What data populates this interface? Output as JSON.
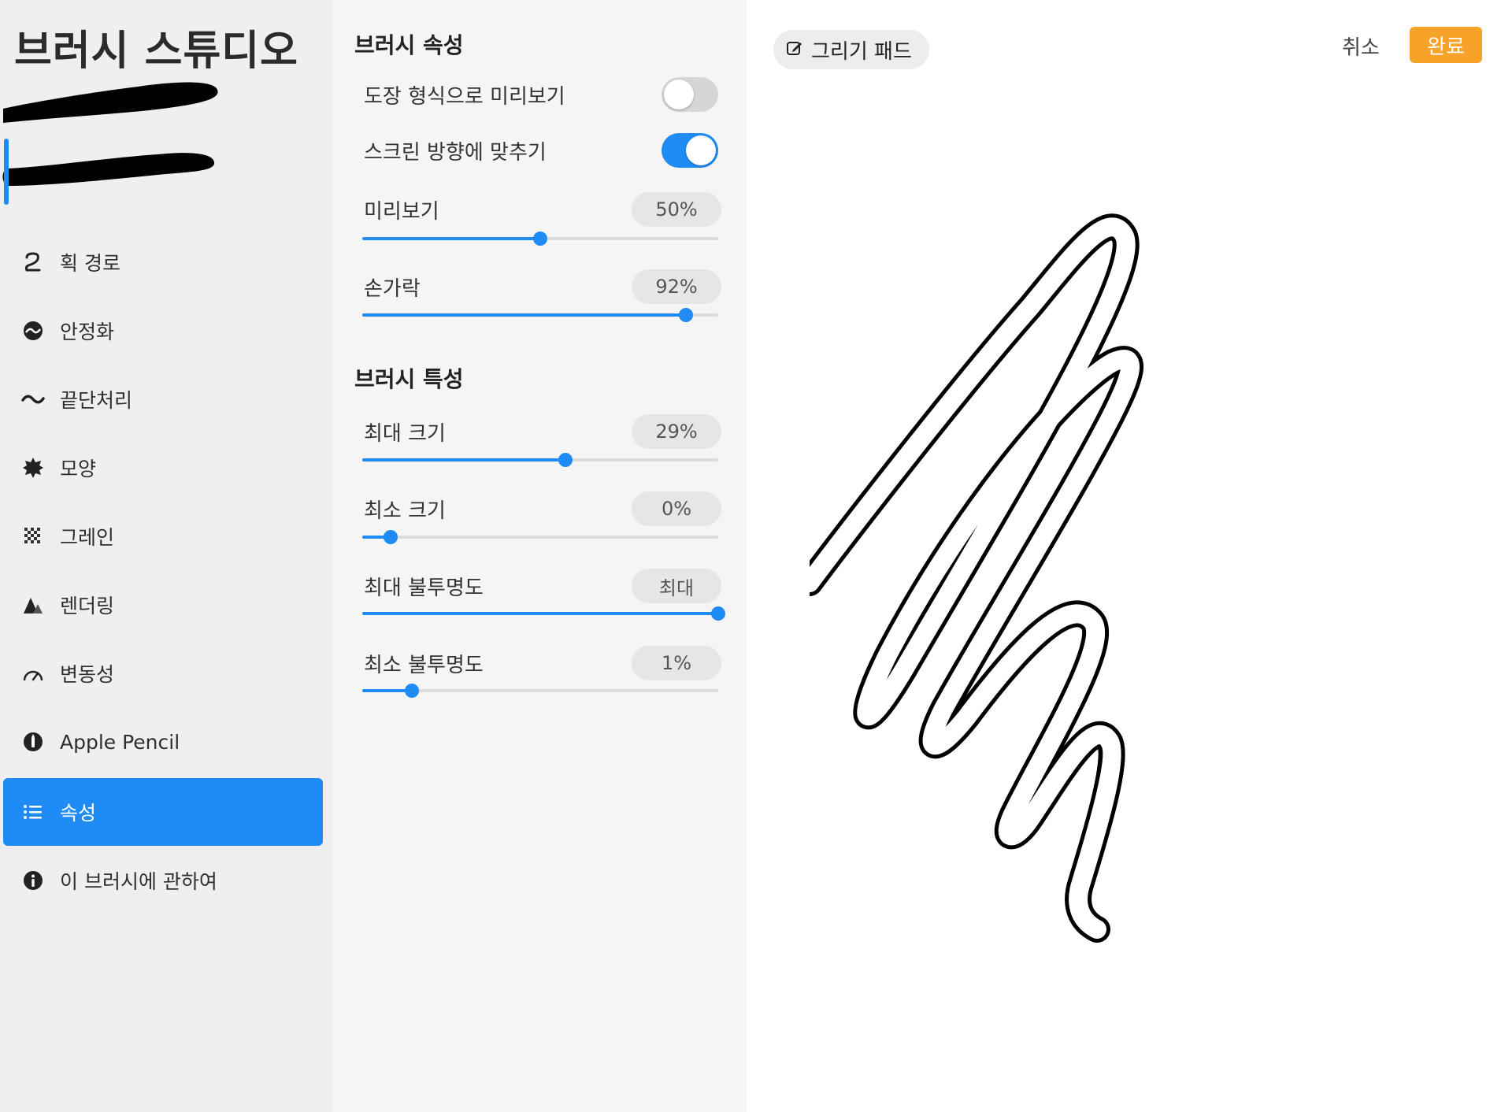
{
  "sidebar": {
    "title": "브러시 스튜디오",
    "items": [
      {
        "label": "획 경로",
        "icon": "stroke-path-icon"
      },
      {
        "label": "안정화",
        "icon": "stabilization-icon"
      },
      {
        "label": "끝단처리",
        "icon": "taper-icon"
      },
      {
        "label": "모양",
        "icon": "shape-icon"
      },
      {
        "label": "그레인",
        "icon": "grain-icon"
      },
      {
        "label": "렌더링",
        "icon": "rendering-icon"
      },
      {
        "label": "변동성",
        "icon": "dynamics-icon"
      },
      {
        "label": "Apple Pencil",
        "icon": "apple-pencil-icon"
      },
      {
        "label": "속성",
        "icon": "properties-icon",
        "active": true
      },
      {
        "label": "이 브러시에 관하여",
        "icon": "info-icon"
      }
    ]
  },
  "settings": {
    "properties_title": "브러시 속성",
    "preview_stamp": {
      "label": "도장 형식으로 미리보기",
      "on": false
    },
    "orient_screen": {
      "label": "스크린 방향에 맞추기",
      "on": true
    },
    "preview": {
      "label": "미리보기",
      "value": "50%",
      "fraction": 0.5
    },
    "finger": {
      "label": "손가락",
      "value": "92%",
      "fraction": 0.91
    },
    "behavior_title": "브러시 특성",
    "max_size": {
      "label": "최대 크기",
      "value": "29%",
      "fraction": 0.57
    },
    "min_size": {
      "label": "최소 크기",
      "value": "0%",
      "fraction": 0.08
    },
    "max_opacity": {
      "label": "최대 불투명도",
      "value": "최대",
      "fraction": 1.0
    },
    "min_opacity": {
      "label": "최소 불투명도",
      "value": "1%",
      "fraction": 0.14
    }
  },
  "pad": {
    "drawing_pad_label": "그리기 패드",
    "drawing_pad_icon": "edit-icon",
    "cancel_label": "취소",
    "done_label": "완료"
  },
  "colors": {
    "accent": "#1f8cf5",
    "done": "#f7a229"
  }
}
